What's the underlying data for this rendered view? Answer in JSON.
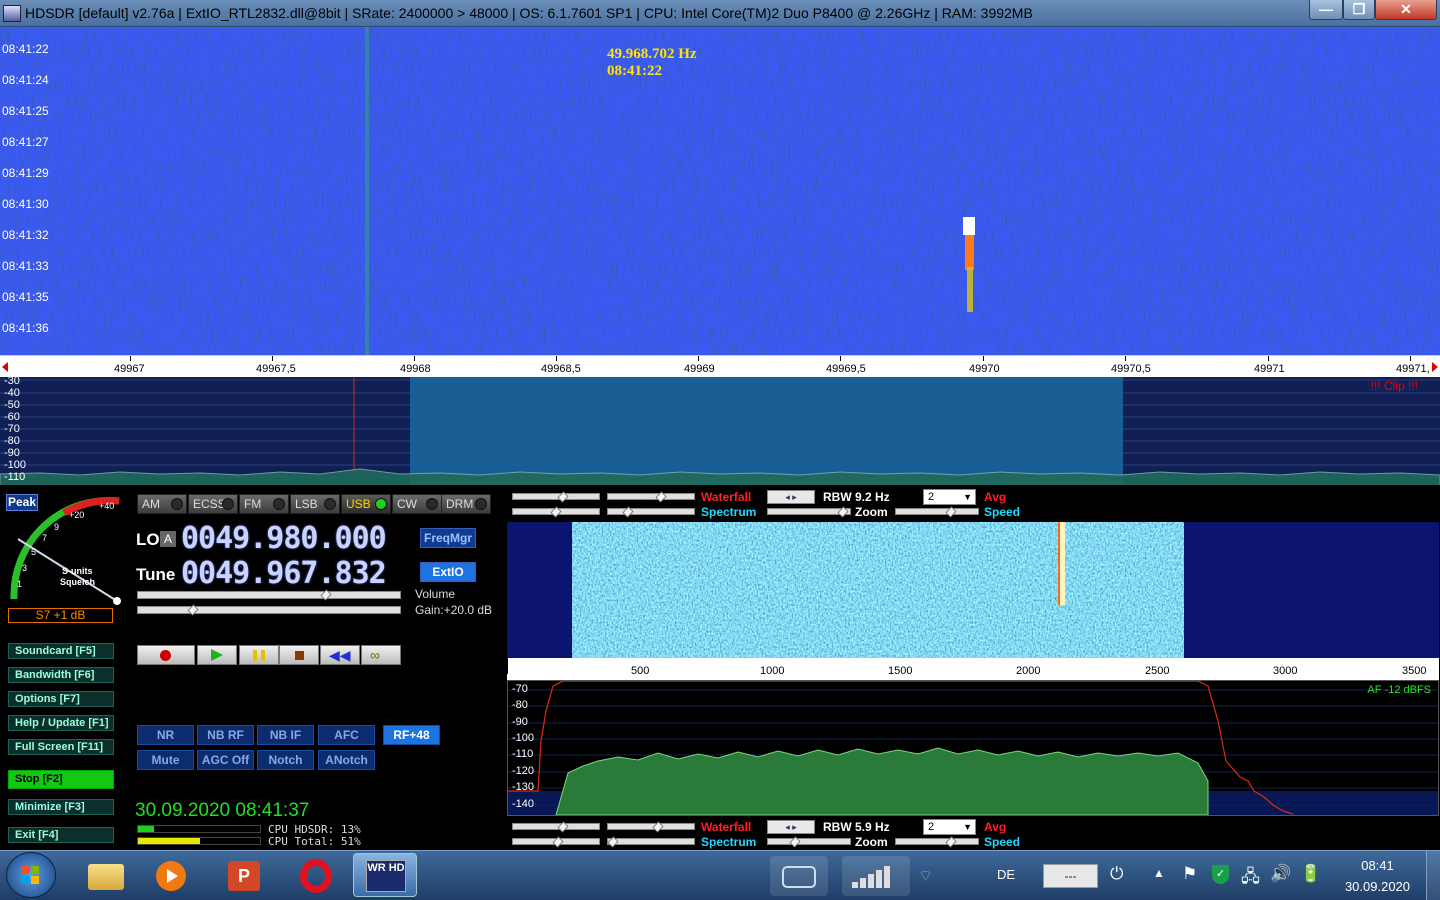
{
  "window": {
    "title": "HDSDR  [default]  v2.76a  |  ExtIO_RTL2832.dll@8bit  |  SRate: 2400000 > 48000  |  OS: 6.1.7601 SP1  |  CPU: Intel Core(TM)2 Duo      P8400  @ 2.26GHz  |  RAM: 3992MB",
    "minimize": "—",
    "maximize": "❐",
    "close": "✕"
  },
  "waterfall_top": {
    "cursor_freq": "49.968.702 Hz",
    "cursor_time": "08:41:22",
    "timestamps": [
      "08:41:22",
      "08:41:24",
      "08:41:25",
      "08:41:27",
      "08:41:29",
      "08:41:30",
      "08:41:32",
      "08:41:33",
      "08:41:35",
      "08:41:36"
    ]
  },
  "freq_scale": [
    "49967",
    "49967,5",
    "49968",
    "49968,5",
    "49969",
    "49969,5",
    "49970",
    "49970,5",
    "49971",
    "49971,"
  ],
  "rf_spectrum": {
    "db_labels": [
      "-30",
      "-40",
      "-50",
      "-60",
      "-70",
      "-80",
      "-90",
      "-100",
      "-110"
    ],
    "clip": "!!! Clip !!!"
  },
  "smeter": {
    "peak": "Peak",
    "reading": "S7 +1 dB",
    "scale": [
      "+40",
      "+20",
      "9",
      "7",
      "5",
      "3",
      "1"
    ],
    "label1": "S-units",
    "label2": "Squelch"
  },
  "modes": [
    "AM",
    "ECSS",
    "FM",
    "LSB",
    "USB",
    "CW",
    "DRM"
  ],
  "lo": {
    "label": "LO",
    "flag": "A",
    "value": "0049.980.000"
  },
  "tune": {
    "label": "Tune",
    "value": "0049.967.832"
  },
  "freqmgr": "FreqMgr",
  "extio": "ExtIO",
  "volume": {
    "label": "Volume",
    "gain": "Gain:+20.0 dB"
  },
  "side_buttons": [
    {
      "label": "Soundcard  [F5]"
    },
    {
      "label": "Bandwidth  [F6]"
    },
    {
      "label": "Options     [F7]"
    },
    {
      "label": "Help / Update  [F1]"
    },
    {
      "label": "Full Screen  [F11]"
    },
    {
      "label": "Stop          [F2]"
    },
    {
      "label": "Minimize  [F3]"
    },
    {
      "label": "Exit          [F4]"
    }
  ],
  "dsp_row1": [
    "NR",
    "NB RF",
    "NB IF",
    "AFC",
    "RF+48"
  ],
  "dsp_row2": [
    "Mute",
    "AGC Off",
    "Notch",
    "ANotch"
  ],
  "datetime": "30.09.2020 08:41:37",
  "cpu": {
    "hdsdr": "CPU HDSDR: 13%",
    "total": "CPU Total: 51%"
  },
  "rf_controls": {
    "waterfall": "Waterfall",
    "spectrum": "Spectrum",
    "rbw": "RBW  9.2 Hz",
    "zoom": "Zoom",
    "avg_value": "2",
    "avg": "Avg",
    "speed": "Speed"
  },
  "af_controls": {
    "waterfall": "Waterfall",
    "spectrum": "Spectrum",
    "rbw": "RBW  5.9 Hz",
    "zoom": "Zoom",
    "avg_value": "2",
    "avg": "Avg",
    "speed": "Speed"
  },
  "af_scale": [
    "500",
    "1000",
    "1500",
    "2000",
    "2500",
    "3000",
    "3500"
  ],
  "af_spectrum": {
    "db_labels": [
      "-70",
      "-80",
      "-90",
      "-100",
      "-110",
      "-120",
      "-130",
      "-140"
    ],
    "level": "AF -12 dBFS"
  },
  "taskbar": {
    "lang": "DE",
    "input_box": "---",
    "time": "08:41",
    "date": "30.09.2020",
    "hdsdr_label": "WR HD"
  }
}
